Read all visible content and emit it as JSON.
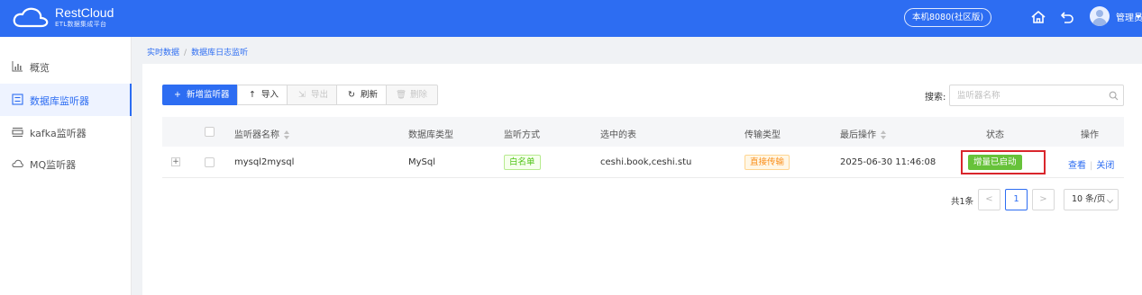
{
  "brand": {
    "name": "RestCloud",
    "subtitle": "ETL数据集成平台"
  },
  "header": {
    "server": "本机8080(社区版)",
    "user": "管理员"
  },
  "sidebar": {
    "items": [
      {
        "label": "概览",
        "icon": "chart-icon",
        "active": false
      },
      {
        "label": "数据库监听器",
        "icon": "list-icon",
        "active": true
      },
      {
        "label": "kafka监听器",
        "icon": "stack-icon",
        "active": false
      },
      {
        "label": "MQ监听器",
        "icon": "cloud-icon",
        "active": false
      }
    ]
  },
  "breadcrumb": {
    "root": "实时数据",
    "separator": "/",
    "current": "数据库日志监听"
  },
  "toolbar": {
    "add_label": "新增监听器",
    "import_label": "导入",
    "export_label": "导出",
    "refresh_label": "刷新",
    "delete_label": "删除"
  },
  "search": {
    "label": "搜索:",
    "placeholder": "监听器名称",
    "value": ""
  },
  "table": {
    "headers": {
      "name": "监听器名称",
      "db_type": "数据库类型",
      "listen_mode": "监听方式",
      "tables": "选中的表",
      "transfer_type": "传输类型",
      "last_op": "最后操作",
      "status": "状态",
      "actions": "操作"
    },
    "rows": [
      {
        "expand": "+",
        "name": "mysql2mysql",
        "db_type": "MySql",
        "listen_mode": "白名单",
        "tables": "ceshi.book,ceshi.stu",
        "transfer_type": "直接传输",
        "last_op": "2025-06-30 11:46:08",
        "status": "增量已启动",
        "action_view": "查看",
        "action_sep": "|",
        "action_close": "关闭"
      }
    ]
  },
  "pagination": {
    "total": "共1条",
    "prev": "<",
    "current_page": "1",
    "next": ">",
    "page_size": "10 条/页"
  },
  "colors": {
    "primary": "#2d6df2",
    "status_green": "#67c23a",
    "highlight_red": "#d9262c"
  }
}
